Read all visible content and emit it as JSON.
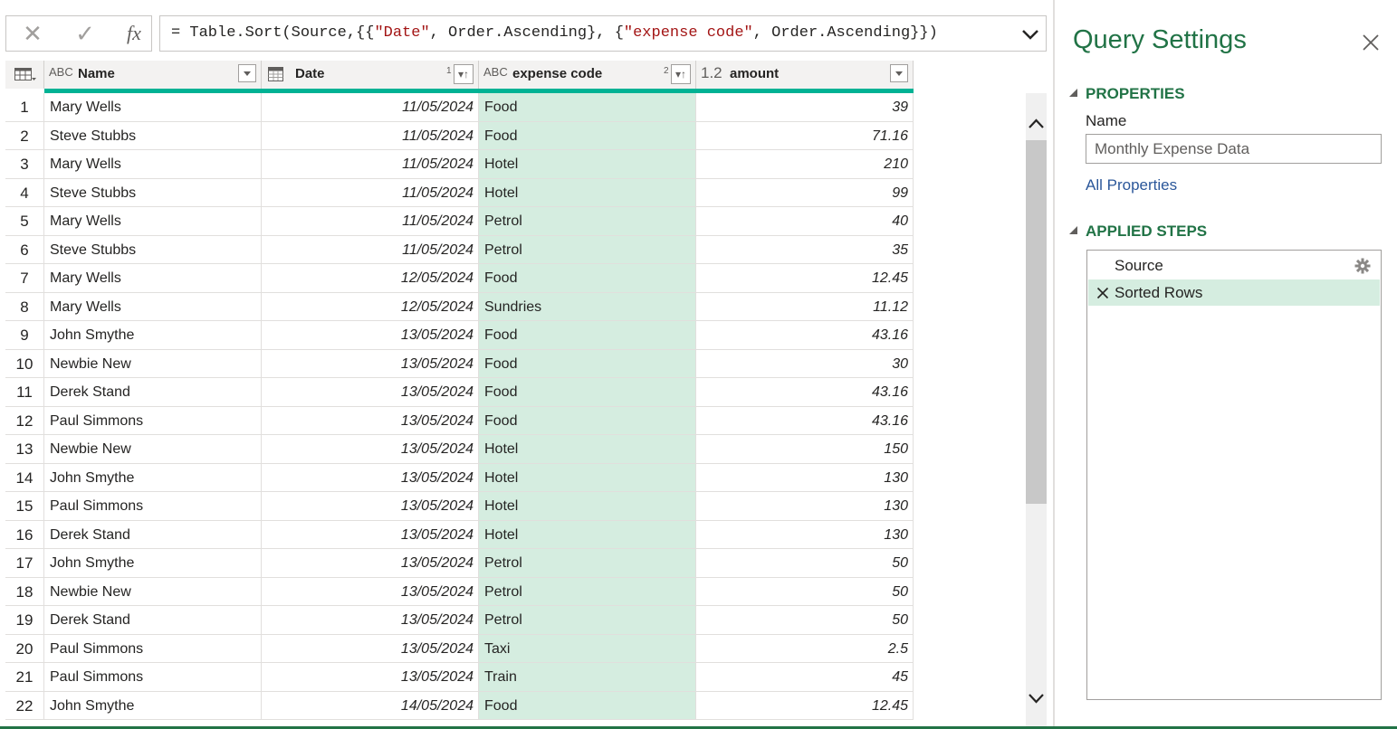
{
  "formula_bar": {
    "cancel_glyph": "✕",
    "commit_glyph": "✓",
    "fx_label": "fx",
    "formula_parts": [
      {
        "text": "= Table.Sort(Source,{{",
        "kind": "code"
      },
      {
        "text": "\"Date\"",
        "kind": "string"
      },
      {
        "text": ", Order.Ascending}, {",
        "kind": "code"
      },
      {
        "text": "\"expense code\"",
        "kind": "string"
      },
      {
        "text": ", Order.Ascending}})",
        "kind": "code"
      }
    ]
  },
  "grid": {
    "columns": [
      {
        "type": "ABC",
        "label": "Name"
      },
      {
        "type": "date",
        "label": "Date",
        "sort_order": "1"
      },
      {
        "type": "ABC",
        "label": "expense code",
        "sort_order": "2"
      },
      {
        "type": "1.2",
        "label": "amount"
      }
    ],
    "rows": [
      {
        "n": "1",
        "name": "Mary Wells",
        "date": "11/05/2024",
        "code": "Food",
        "amount": "39"
      },
      {
        "n": "2",
        "name": " Steve Stubbs",
        "date": "11/05/2024",
        "code": "Food",
        "amount": "71.16"
      },
      {
        "n": "3",
        "name": "Mary Wells",
        "date": "11/05/2024",
        "code": "Hotel",
        "amount": "210"
      },
      {
        "n": "4",
        "name": " Steve Stubbs",
        "date": "11/05/2024",
        "code": "Hotel",
        "amount": "99"
      },
      {
        "n": "5",
        "name": "Mary Wells",
        "date": "11/05/2024",
        "code": "Petrol",
        "amount": "40"
      },
      {
        "n": "6",
        "name": " Steve Stubbs",
        "date": "11/05/2024",
        "code": "Petrol",
        "amount": "35"
      },
      {
        "n": "7",
        "name": "Mary Wells",
        "date": "12/05/2024",
        "code": "Food",
        "amount": "12.45"
      },
      {
        "n": "8",
        "name": "Mary Wells",
        "date": "12/05/2024",
        "code": "Sundries",
        "amount": "11.12"
      },
      {
        "n": "9",
        "name": " John Smythe",
        "date": "13/05/2024",
        "code": "Food",
        "amount": "43.16"
      },
      {
        "n": "10",
        "name": "Newbie New",
        "date": "13/05/2024",
        "code": "Food",
        "amount": "30"
      },
      {
        "n": "11",
        "name": "Derek Stand",
        "date": "13/05/2024",
        "code": "Food",
        "amount": "43.16"
      },
      {
        "n": "12",
        "name": "Paul Simmons",
        "date": "13/05/2024",
        "code": "Food",
        "amount": "43.16"
      },
      {
        "n": "13",
        "name": "Newbie New",
        "date": "13/05/2024",
        "code": "Hotel",
        "amount": "150"
      },
      {
        "n": "14",
        "name": " John Smythe",
        "date": "13/05/2024",
        "code": "Hotel",
        "amount": "130"
      },
      {
        "n": "15",
        "name": "Paul Simmons",
        "date": "13/05/2024",
        "code": "Hotel",
        "amount": "130"
      },
      {
        "n": "16",
        "name": "Derek Stand",
        "date": "13/05/2024",
        "code": "Hotel",
        "amount": "130"
      },
      {
        "n": "17",
        "name": " John Smythe",
        "date": "13/05/2024",
        "code": "Petrol",
        "amount": "50"
      },
      {
        "n": "18",
        "name": "Newbie New",
        "date": "13/05/2024",
        "code": "Petrol",
        "amount": "50"
      },
      {
        "n": "19",
        "name": "Derek Stand",
        "date": "13/05/2024",
        "code": "Petrol",
        "amount": "50"
      },
      {
        "n": "20",
        "name": "Paul Simmons",
        "date": "13/05/2024",
        "code": "Taxi",
        "amount": "2.5"
      },
      {
        "n": "21",
        "name": "Paul Simmons",
        "date": "13/05/2024",
        "code": "Train",
        "amount": "45"
      },
      {
        "n": "22",
        "name": " John Smythe",
        "date": "14/05/2024",
        "code": "Food",
        "amount": "12.45"
      }
    ]
  },
  "query_settings": {
    "title": "Query Settings",
    "properties_heading": "PROPERTIES",
    "name_label": "Name",
    "name_value": "Monthly Expense Data",
    "all_properties_link": "All Properties",
    "applied_steps_heading": "APPLIED STEPS",
    "steps": [
      {
        "label": "Source",
        "selected": false,
        "icon": "gear-icon"
      },
      {
        "label": "Sorted Rows",
        "selected": true,
        "icon": "delete-x-icon"
      }
    ]
  },
  "colors": {
    "accent_green": "#217346",
    "column_quality_bar": "#00b294",
    "selected_column_fill": "#d5ede0",
    "formula_string": "#a31515"
  }
}
